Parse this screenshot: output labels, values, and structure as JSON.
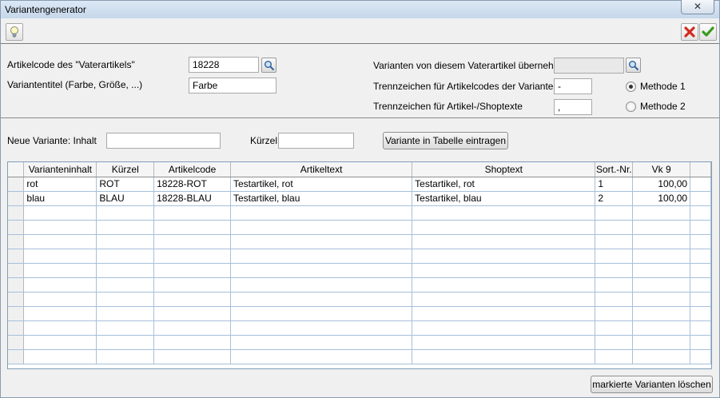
{
  "window": {
    "title": "Variantengenerator",
    "close_glyph": "✕"
  },
  "toolbar": {
    "hint_icon": "lightbulb-icon",
    "cancel_icon": "red-x-icon",
    "ok_icon": "green-check-icon"
  },
  "form": {
    "artikelcode_label": "Artikelcode des \"Vaterartikels\"",
    "artikelcode_value": "18228",
    "variantentitel_label": "Variantentitel (Farbe, Größe, ...)",
    "variantentitel_value": "Farbe",
    "uebernehmen_label": "Varianten von diesem Vaterartikel übernehmen",
    "uebernehmen_value": "",
    "trenn_codes_label": "Trennzeichen für Artikelcodes der Varianten",
    "trenn_codes_value": "-",
    "trenn_texte_label": "Trennzeichen für Artikel-/Shoptexte",
    "trenn_texte_value": ",",
    "methode1_label": "Methode 1",
    "methode2_label": "Methode 2",
    "selected_method": "Methode 1"
  },
  "new_variant": {
    "inhalt_label": "Neue Variante: Inhalt",
    "inhalt_value": "",
    "kuerzel_label": "Kürzel",
    "kuerzel_value": "",
    "add_button": "Variante in Tabelle eintragen"
  },
  "table": {
    "columns": [
      "Varianteninhalt",
      "Kürzel",
      "Artikelcode",
      "Artikeltext",
      "Shoptext",
      "Sort.-Nr.",
      "Vk 9"
    ],
    "rows": [
      [
        "rot",
        "ROT",
        "18228-ROT",
        "Testartikel, rot",
        "Testartikel, rot",
        "1",
        "100,00"
      ],
      [
        "blau",
        "BLAU",
        "18228-BLAU",
        "Testartikel, blau",
        "Testartikel, blau",
        "2",
        "100,00"
      ]
    ],
    "empty_rows": 11
  },
  "footer": {
    "delete_button": "markierte Varianten löschen"
  }
}
